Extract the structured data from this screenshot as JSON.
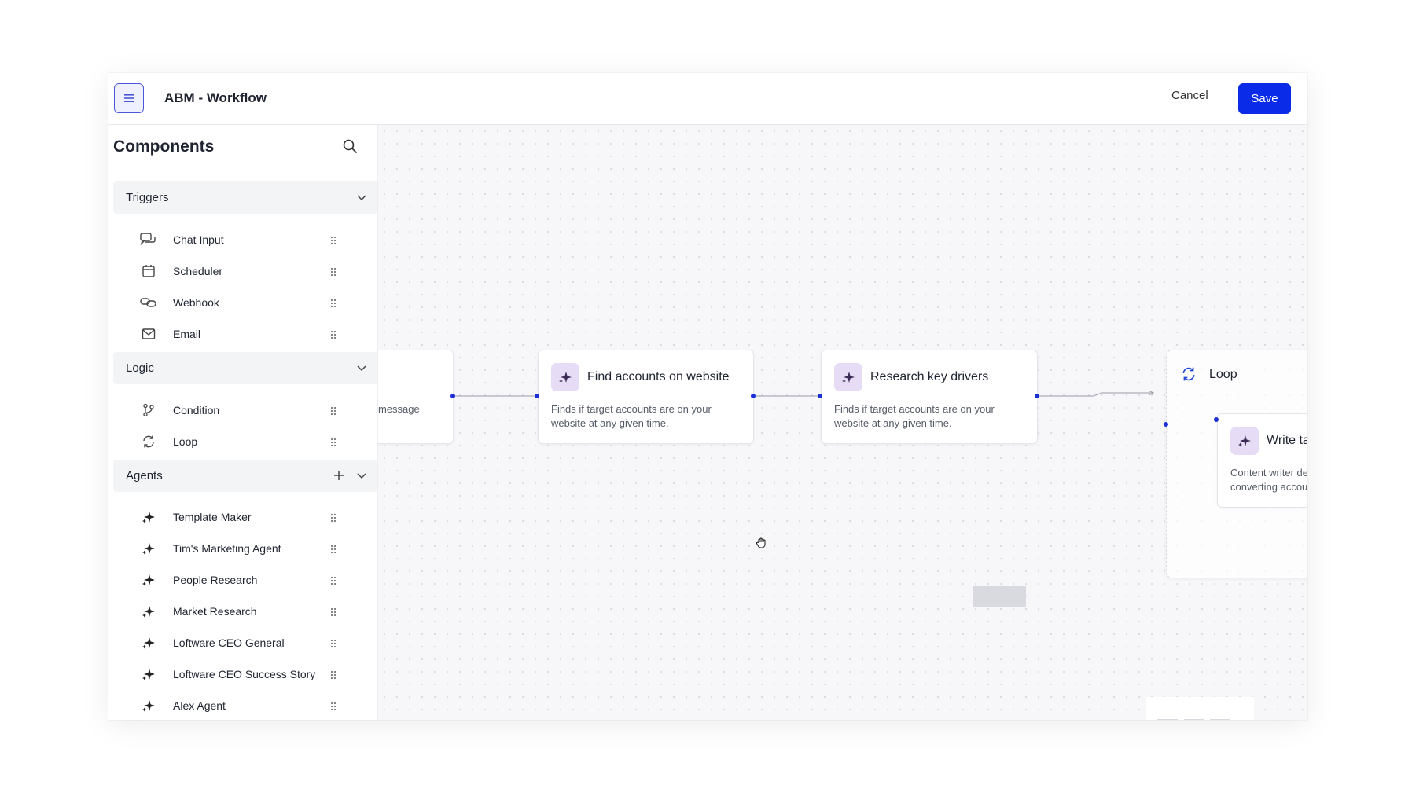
{
  "header": {
    "title": "ABM - Workflow",
    "cancel_label": "Cancel",
    "save_label": "Save"
  },
  "sidebar": {
    "title": "Components",
    "sections": [
      {
        "label": "Triggers",
        "items": [
          {
            "label": "Chat Input",
            "icon": "chat-icon"
          },
          {
            "label": "Scheduler",
            "icon": "calendar-icon"
          },
          {
            "label": "Webhook",
            "icon": "webhook-icon"
          },
          {
            "label": "Email",
            "icon": "mail-icon"
          }
        ]
      },
      {
        "label": "Logic",
        "items": [
          {
            "label": "Condition",
            "icon": "branch-icon"
          },
          {
            "label": "Loop",
            "icon": "loop-icon"
          }
        ]
      },
      {
        "label": "Agents",
        "items": [
          {
            "label": "Template Maker",
            "icon": "sparkle-icon"
          },
          {
            "label": "Tim's Marketing Agent",
            "icon": "sparkle-icon"
          },
          {
            "label": "People Research",
            "icon": "sparkle-icon"
          },
          {
            "label": "Market Research",
            "icon": "sparkle-icon"
          },
          {
            "label": "Loftware CEO General",
            "icon": "sparkle-icon"
          },
          {
            "label": "Loftware CEO Success Story",
            "icon": "sparkle-icon"
          },
          {
            "label": "Alex Agent",
            "icon": "sparkle-icon"
          }
        ]
      }
    ]
  },
  "canvas": {
    "nodes": [
      {
        "title": "",
        "description": "message"
      },
      {
        "title": "Find accounts on website",
        "description": "Finds if target accounts are on your website at any given time."
      },
      {
        "title": "Research key drivers",
        "description": "Finds if target accounts are on your website at any given time."
      },
      {
        "title": "Write ta",
        "description": "Content writer de converting accou"
      }
    ],
    "loop_label": "Loop"
  },
  "colors": {
    "accent": "#0a2ce8",
    "connector": "#1c2fd6",
    "node_icon_bg": "#e7dcf5"
  }
}
